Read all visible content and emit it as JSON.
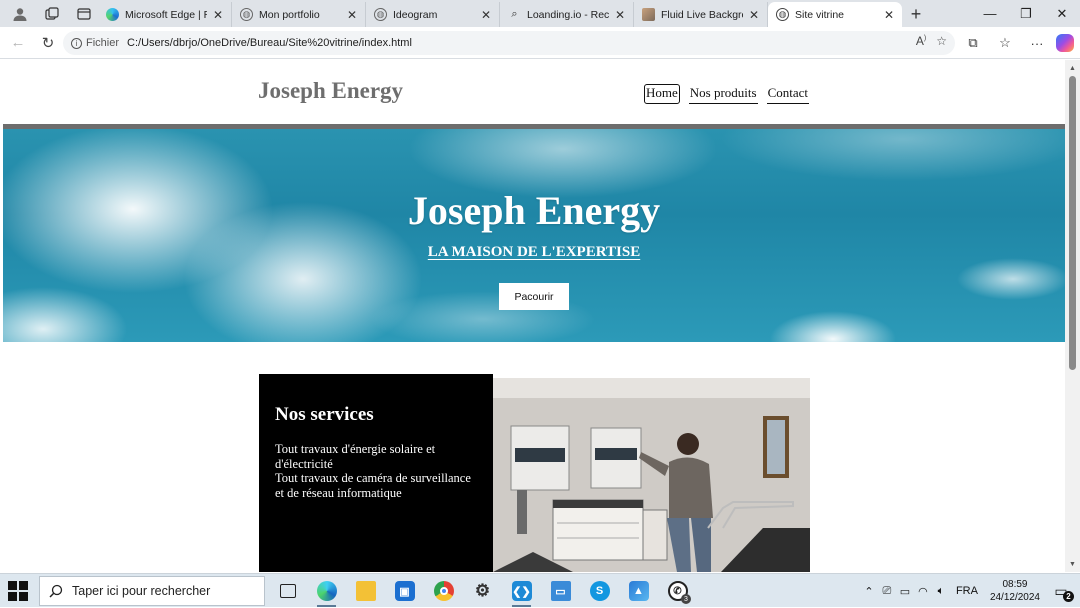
{
  "browser": {
    "tabs": [
      {
        "title": "Microsoft Edge | Rés",
        "favicon": "edge-icon",
        "active": false
      },
      {
        "title": "Mon portfolio",
        "favicon": "globe-icon",
        "active": false
      },
      {
        "title": "Ideogram",
        "favicon": "globe-icon",
        "active": false
      },
      {
        "title": "Loanding.io - Recher",
        "favicon": "search-icon",
        "active": false
      },
      {
        "title": "Fluid Live Backgroun",
        "favicon": "image-icon",
        "active": false
      },
      {
        "title": "Site vitrine",
        "favicon": "globe-icon",
        "active": true
      }
    ],
    "address": {
      "scheme_label": "Fichier",
      "url": "C:/Users/dbrjo/OneDrive/Bureau/Site%20vitrine/index.html"
    }
  },
  "site": {
    "brand": "Joseph Energy",
    "nav": [
      "Home",
      "Nos produits",
      "Contact"
    ],
    "hero": {
      "title": "Joseph Energy",
      "subtitle": "LA MAISON DE L'EXPERTISE",
      "button": "Pacourir"
    },
    "services": {
      "title": "Nos services",
      "line1": "Tout travaux d'énergie solaire et d'électricité",
      "line2": "Tout travaux de caméra de surveillance et de réseau informatique"
    }
  },
  "taskbar": {
    "search_placeholder": "Taper ici pour rechercher",
    "language": "FRA",
    "time": "08:59",
    "date": "24/12/2024",
    "whatsapp_badge": "3",
    "notification_count": "2"
  },
  "colors": {
    "hero_sky": "#1f86a6",
    "services_bg": "#000000",
    "brand_text": "#6e6e6e",
    "header_rule": "#6d6d6d"
  }
}
